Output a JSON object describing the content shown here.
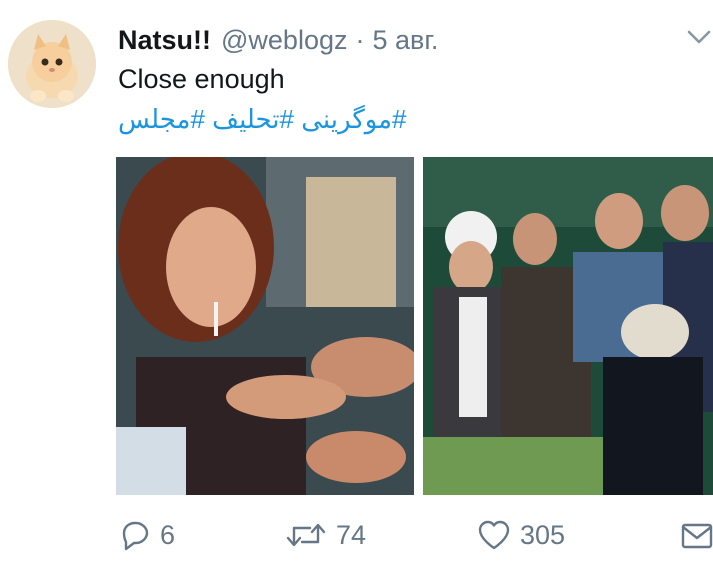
{
  "tweet": {
    "display_name": "Natsu!!",
    "handle": "@weblogz",
    "separator": "·",
    "date": "5 авг.",
    "text": "Close enough",
    "hashtags": "#موگرینی #تحلیف #مجلس"
  },
  "icons": {
    "caret": "chevron-down-icon",
    "reply": "reply-icon",
    "retweet": "retweet-icon",
    "like": "heart-icon",
    "dm": "envelope-icon"
  },
  "actions": {
    "reply_count": "6",
    "retweet_count": "74",
    "like_count": "305"
  },
  "colors": {
    "link": "#1b95e0",
    "secondary": "#657786",
    "primary_text": "#14171a"
  }
}
